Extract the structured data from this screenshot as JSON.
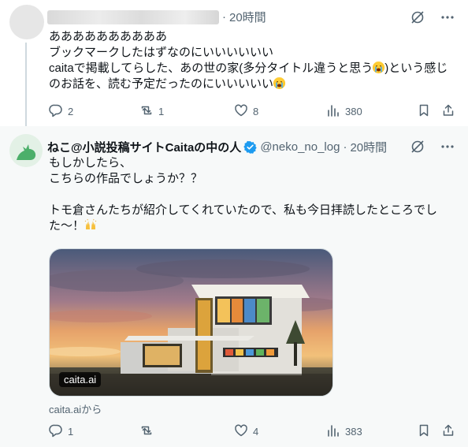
{
  "tweet1": {
    "time": "20時間",
    "lines": [
      "ああああああああああ",
      "ブックマークしたはずなのにいいいいいい",
      "caitaで掲載してらした、あの世の家(多分タイトル違うと思う",
      ")という感じ",
      "のお話を、読む予定だったのにいいいいい"
    ],
    "stats": {
      "replies": "2",
      "retweets": "1",
      "likes": "8",
      "views": "380"
    }
  },
  "tweet2": {
    "display_name": "ねこ@小説投稿サイトCaitaの中の人",
    "handle": "@neko_no_log",
    "time": "20時間",
    "lines": [
      "もしかしたら、",
      "こちらの作品でしょうか？？",
      "",
      "トモ倉さんたちが紹介してくれていたので、私も今日拝読したところでし",
      "た〜！"
    ],
    "card_badge": "caita.ai",
    "card_source": "caita.aiから",
    "stats": {
      "replies": "1",
      "retweets": "",
      "likes": "4",
      "views": "383"
    }
  },
  "separator": "·",
  "colors": {
    "text": "#0f1419",
    "secondary": "#536471",
    "verified": "#1d9bf0",
    "thread": "#cfd9de"
  },
  "icons": [
    "grok-icon",
    "more-icon",
    "reply-icon",
    "retweet-icon",
    "like-icon",
    "views-icon",
    "bookmark-icon",
    "share-icon",
    "verified-badge-icon",
    "loudly-crying-face-emoji",
    "raising-hands-emoji"
  ]
}
